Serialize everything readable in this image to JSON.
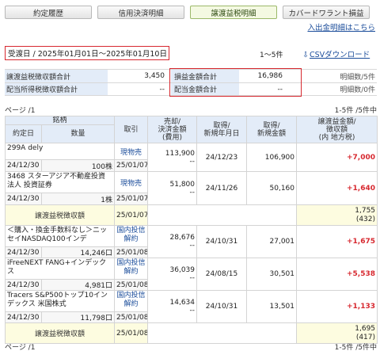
{
  "tabs": [
    "約定履歴",
    "信用決済明細",
    "譲渡益税明細",
    "カバードワラント損益"
  ],
  "active_tab": 2,
  "link_nyushukkin": "入出金明細はこちら",
  "filter_text": "受渡日 / 2025年01月01日～2025年01月10日",
  "result_count": "1～5件",
  "csv_label": "CSVダウンロード",
  "csv_icon": "download-icon",
  "summary": {
    "row1": {
      "label1": "譲渡益税徴収額合計",
      "value1": "3,450",
      "label2": "損益金額合計",
      "value2": "16,986",
      "note": "明細数/5件"
    },
    "row2": {
      "label1": "配当所得税徴収額合計",
      "value1": "--",
      "label2": "配当金額合計",
      "value2": "--",
      "note": "明細数/0件"
    }
  },
  "page_label": "ページ /1",
  "page_count_right": "1-5件 /5件中",
  "headers": {
    "meigara": "銘柄",
    "yakujobi": "約定日",
    "suryo": "数量",
    "torihiki": "取引",
    "urine": "売却/\n決済金額",
    "hiyo": "(費用)",
    "shutoku_bi": "取得/\n新規年月日",
    "shutoku_kin": "取得/\n新規金額",
    "joto": "譲渡益金額/\n徴収額",
    "uchi": "(内 地方税)"
  },
  "rows": [
    {
      "name": "299A dely",
      "date": "24/12/30",
      "qty": "100株",
      "trade": "現物売",
      "trade_date": "25/01/07",
      "sell": "113,900",
      "fee": "--",
      "acq_date": "24/12/23",
      "acq_amt": "106,900",
      "pl": "+7,000"
    },
    {
      "name": "3468 スターアジア不動産投資法人 投資証券",
      "date": "24/12/30",
      "qty": "1株",
      "trade": "現物売",
      "trade_date": "25/01/07",
      "sell": "51,800",
      "fee": "--",
      "acq_date": "24/11/26",
      "acq_amt": "50,160",
      "pl": "+1,640"
    },
    {
      "name": "＜購入・換金手数料なし＞ニッセイNASDAQ100インデ",
      "date": "24/12/30",
      "qty": "14,246口",
      "trade": "国内投信解約",
      "trade_date": "25/01/08",
      "sell": "28,676",
      "fee": "--",
      "acq_date": "24/10/31",
      "acq_amt": "27,001",
      "pl": "+1,675"
    },
    {
      "name": "iFreeNEXT FANG+インデックス",
      "date": "24/12/30",
      "qty": "4,981口",
      "trade": "国内投信解約",
      "trade_date": "25/01/08",
      "sell": "36,039",
      "fee": "--",
      "acq_date": "24/08/15",
      "acq_amt": "30,501",
      "pl": "+5,538"
    },
    {
      "name": "Tracers S&P500トップ10インデックス 米国株式",
      "date": "24/12/30",
      "qty": "11,798口",
      "trade": "国内投信解約",
      "trade_date": "25/01/08",
      "sell": "14,634",
      "fee": "--",
      "acq_date": "24/10/31",
      "acq_amt": "13,501",
      "pl": "+1,133"
    }
  ],
  "tax_rows": [
    {
      "label": "譲渡益税徴収額",
      "date": "25/01/07",
      "amount": "1,755",
      "local": "(432)"
    },
    {
      "label": "譲渡益税徴収額",
      "date": "25/01/08",
      "amount": "1,695",
      "local": "(417)"
    }
  ],
  "footer_page": "ページ /1",
  "footer_count": "1-5件 /5件中"
}
